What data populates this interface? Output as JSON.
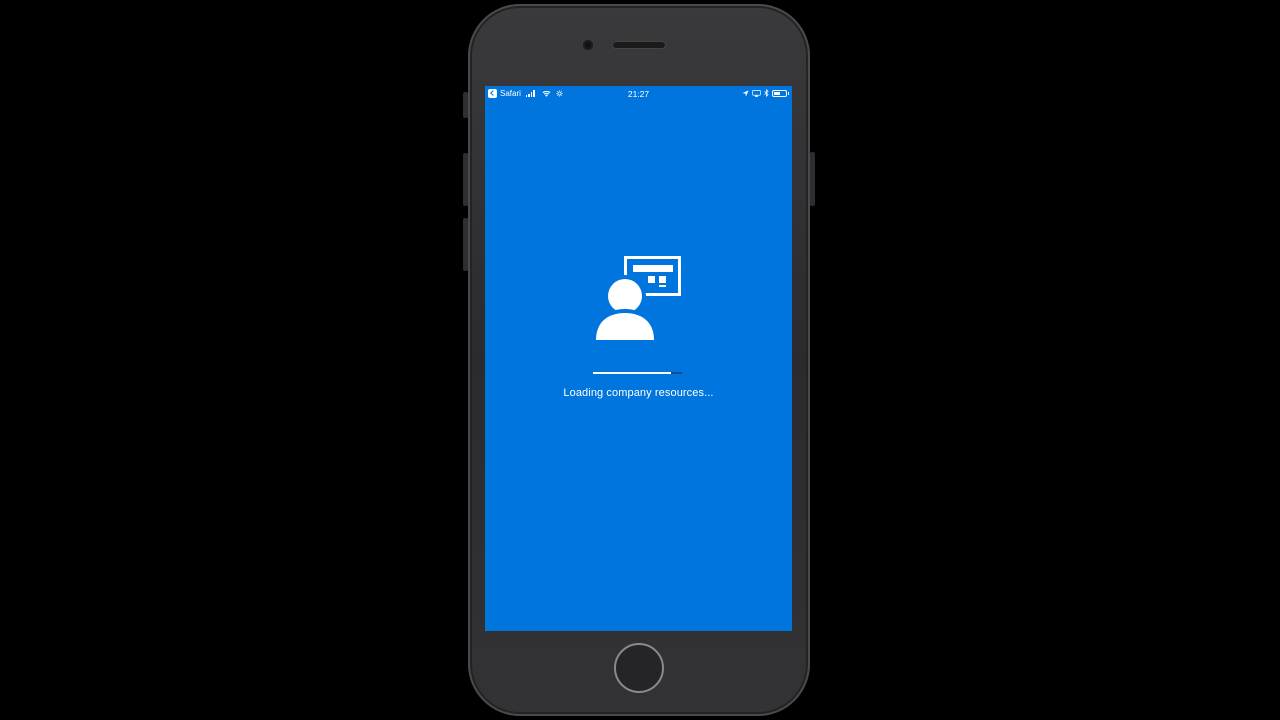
{
  "status_bar": {
    "back_app_label": "Safari",
    "time": "21:27",
    "back_icon": "back-chevron-icon",
    "signal_icon": "cellular-signal-icon",
    "wifi_icon": "wifi-icon",
    "activity_icon": "activity-gear-icon",
    "location_icon": "location-arrow-icon",
    "screen_mirroring_icon": "screen-mirroring-icon",
    "bluetooth_icon": "bluetooth-icon",
    "battery_icon": "battery-icon",
    "battery_level": 0.5
  },
  "splash": {
    "logo_icon": "user-with-dashboard-icon",
    "loading_text": "Loading company resources...",
    "progress": 0.88
  },
  "colors": {
    "screen_background": "#0075de",
    "progress_track": "#0a4f92",
    "progress_fill": "#ffffff",
    "text": "#ffffff"
  }
}
